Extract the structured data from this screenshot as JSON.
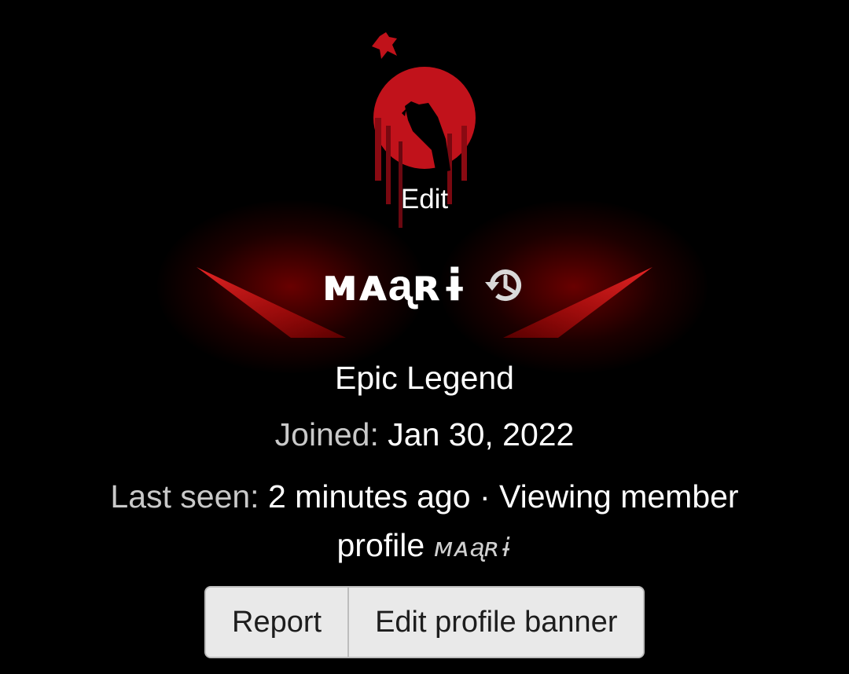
{
  "avatar": {
    "edit_label": "Edit"
  },
  "user": {
    "name": "ᴍᴀᶏʀɨ",
    "rank": "Epic Legend",
    "joined_label": "Joined:",
    "joined_value": "Jan 30, 2022",
    "last_seen_label": "Last seen:",
    "last_seen_value": "2 minutes ago",
    "separator": " · ",
    "activity": "Viewing member profile",
    "activity_target": "ᴍᴀᶏʀɨ"
  },
  "actions": {
    "report_label": "Report",
    "edit_banner_label": "Edit profile banner"
  },
  "colors": {
    "background": "#000000",
    "accent_red": "#d0101a",
    "button_bg": "#e9e9e9",
    "muted_text": "#c9c9c9"
  },
  "icons": {
    "history": "history-icon"
  }
}
